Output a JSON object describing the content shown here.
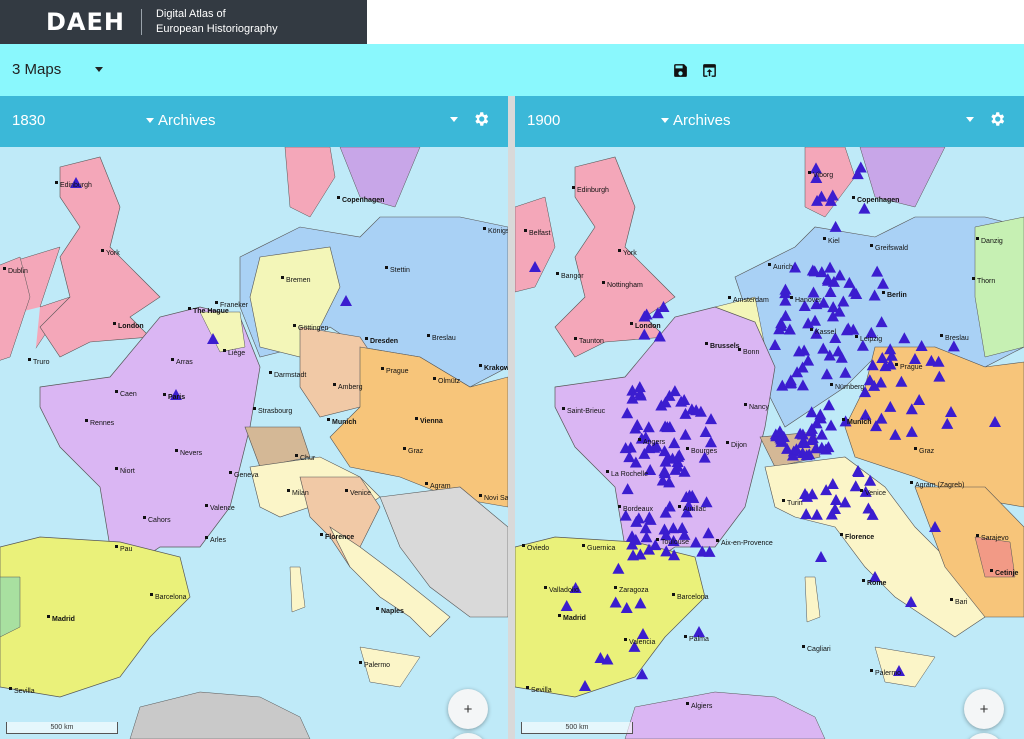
{
  "brand": {
    "logo": "DAEH",
    "line1": "Digital Atlas of",
    "line2": "European Historiography"
  },
  "toolbar": {
    "maps_label": "3 Maps",
    "save_icon": "save-icon",
    "export_icon": "export-icon"
  },
  "panels": [
    {
      "year": "1830",
      "layer": "Archives",
      "scale": "500 km",
      "zoom_in": "+",
      "zoom_out": "−",
      "cities": [
        "Edinburgh",
        "Copenhagen",
        "Königsberg",
        "York",
        "Dublin",
        "Bremen",
        "Stettin",
        "Franeker",
        "The Hague",
        "Göttingen",
        "London",
        "Liège",
        "Dresden",
        "Breslau",
        "Truro",
        "Arras",
        "Darmstadt",
        "Prague",
        "Krakow",
        "Olmütz",
        "Caen",
        "Amberg",
        "Paris",
        "Strasbourg",
        "Rennes",
        "Munich",
        "Vienna",
        "Nevers",
        "Chur",
        "Graz",
        "Niort",
        "Geneva",
        "Agram",
        "Milan",
        "Venice",
        "Novi Sad",
        "Valence",
        "Cahors",
        "Arles",
        "Florence",
        "Pau",
        "Barcelona",
        "Madrid",
        "Naples",
        "Palermo",
        "Sevilla"
      ]
    },
    {
      "year": "1900",
      "layer": "Archives",
      "scale": "500 km",
      "zoom_in": "+",
      "zoom_out": "−",
      "cities": [
        "Viborg",
        "Copenhagen",
        "Edinburgh",
        "Kiel",
        "Greifswald",
        "Danzig",
        "Belfast",
        "York",
        "Aurich",
        "Bangor",
        "Berlin",
        "Thorn",
        "Nottingham",
        "Amsterdam",
        "Hanover",
        "London",
        "Kassel",
        "Leipzig",
        "Breslau",
        "Taunton",
        "Brussels",
        "Prague",
        "Bonn",
        "Saint-Brieuc",
        "Nürnberg",
        "Nancy",
        "Munich",
        "Angers",
        "Bourges",
        "Dijon",
        "Graz",
        "La Rochelle",
        "Turin",
        "Venice",
        "Agram (Zagreb)",
        "Bordeaux",
        "Aurillac",
        "Toulouse",
        "Florence",
        "Aix-en-Provence",
        "Sarajevo",
        "Oviedo",
        "Guernica",
        "Cetinje",
        "Zaragoza",
        "Barcelona",
        "Rome",
        "Valladolid",
        "Madrid",
        "Bari",
        "Palma",
        "Valencia",
        "Cagliari",
        "Palermo",
        "Sevilla",
        "Algiers"
      ]
    }
  ]
}
